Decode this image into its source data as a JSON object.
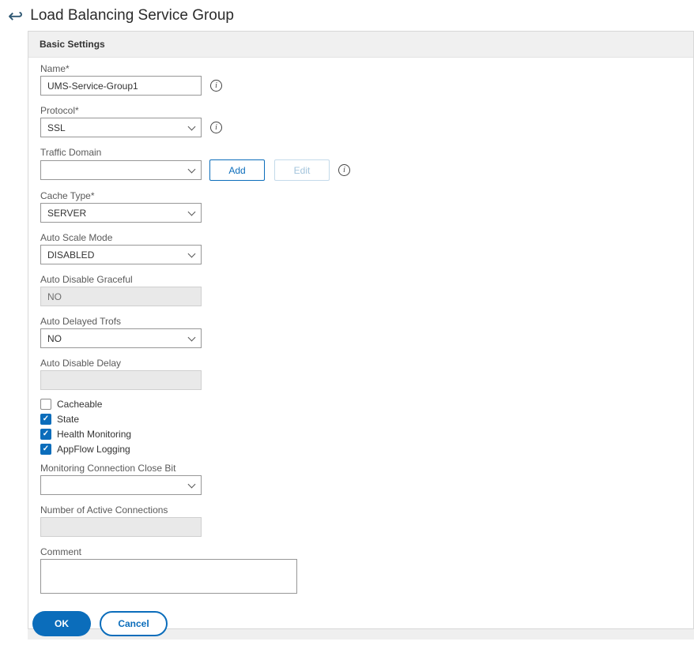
{
  "colors": {
    "accent": "#0b6dbb",
    "panel_header_bg": "#f0f0f0"
  },
  "icons": {
    "back": "↩",
    "info": "i",
    "check": "✓"
  },
  "header": {
    "title": "Load Balancing Service Group"
  },
  "panel": {
    "title": "Basic Settings"
  },
  "fields": {
    "name": {
      "label": "Name*",
      "value": "UMS-Service-Group1"
    },
    "protocol": {
      "label": "Protocol*",
      "value": "SSL"
    },
    "traffic_domain": {
      "label": "Traffic Domain",
      "value": ""
    },
    "cache_type": {
      "label": "Cache Type*",
      "value": "SERVER"
    },
    "auto_scale_mode": {
      "label": "Auto Scale Mode",
      "value": "DISABLED"
    },
    "auto_disable_graceful": {
      "label": "Auto Disable Graceful",
      "value": "NO"
    },
    "auto_delayed_trofs": {
      "label": "Auto Delayed Trofs",
      "value": "NO"
    },
    "auto_disable_delay": {
      "label": "Auto Disable Delay",
      "value": ""
    },
    "monitoring_connection_close_bit": {
      "label": "Monitoring Connection Close Bit",
      "value": ""
    },
    "number_of_active_connections": {
      "label": "Number of Active Connections",
      "value": ""
    },
    "comment": {
      "label": "Comment",
      "value": ""
    }
  },
  "checkboxes": [
    {
      "label": "Cacheable",
      "checked": false
    },
    {
      "label": "State",
      "checked": true
    },
    {
      "label": "Health Monitoring",
      "checked": true
    },
    {
      "label": "AppFlow Logging",
      "checked": true
    }
  ],
  "buttons": {
    "add": "Add",
    "edit": "Edit",
    "ok": "OK",
    "cancel": "Cancel"
  }
}
